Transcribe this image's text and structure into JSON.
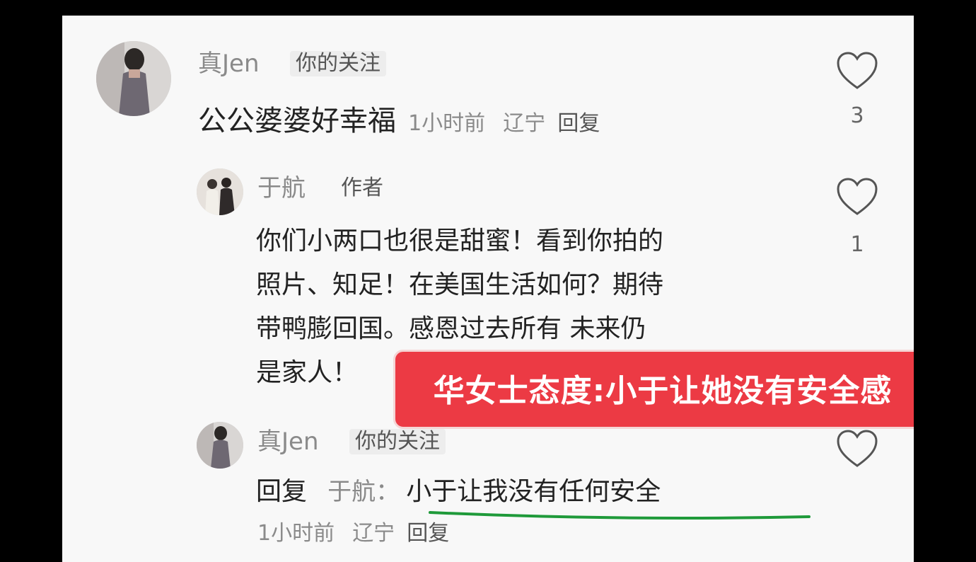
{
  "comment1": {
    "username": "真Jen",
    "tag": "你的关注",
    "text": "公公婆婆好幸福",
    "time": "1小时前",
    "location": "辽宁",
    "reply_label": "回复",
    "likes": "3"
  },
  "reply1": {
    "username": "于航",
    "tag": "作者",
    "lines": [
      "你们小两口也很是甜蜜！看到你拍的",
      "照片、知足！在美国生活如何？期待",
      "带鸭膨回国。感恩过去所有 未来仍",
      "是家人！"
    ],
    "likes": "1"
  },
  "reply2": {
    "username": "真Jen",
    "tag": "你的关注",
    "reply_prefix": "回复",
    "reply_to": "于航：",
    "text": "小于让我没有任何安全",
    "time": "1小时前",
    "location": "辽宁",
    "reply_label": "回复"
  },
  "banner": {
    "text": "华女士态度:小于让她没有安全感"
  },
  "colors": {
    "banner_bg": "#ec3a44",
    "underline": "#1f9a3a",
    "panel_bg": "#f8f8f8"
  }
}
